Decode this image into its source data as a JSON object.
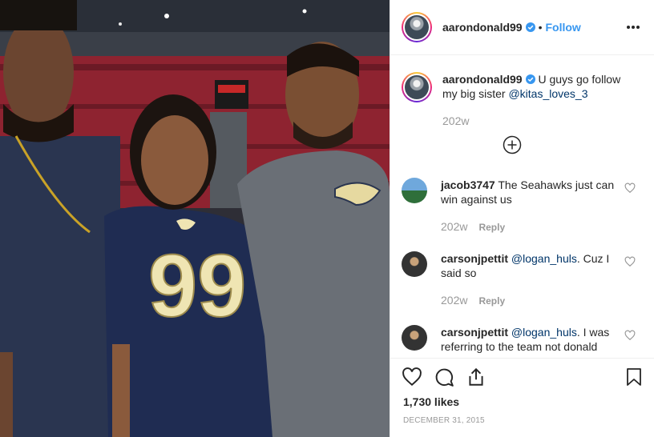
{
  "post": {
    "author": "aarondonald99",
    "follow_label": "Follow",
    "separator": "•",
    "more_icon": "more-horizontal-icon",
    "verified_icon": "verified-badge-icon",
    "colors": {
      "link": "#3897f0",
      "mention": "#003569",
      "muted": "#999999",
      "text": "#262626"
    }
  },
  "caption": {
    "user": "aarondonald99",
    "text": "U guys go follow my big sister ",
    "mention": "@kitas_loves_3",
    "time": "202w",
    "load_more_icon": "plus-circle-icon"
  },
  "comments": [
    {
      "user": "jacob3747",
      "text": "The Seahawks just can win against us",
      "mention": "",
      "time": "202w",
      "reply": "Reply"
    },
    {
      "user": "carsonjpettit",
      "mention": "@logan_huls",
      "text": ". Cuz I said so",
      "time": "202w",
      "reply": "Reply"
    },
    {
      "user": "carsonjpettit",
      "mention": "@logan_huls",
      "text": ". I was referring to the team not donald",
      "time": "",
      "reply": ""
    }
  ],
  "actions": {
    "like_icon": "heart-icon",
    "comment_icon": "comment-icon",
    "share_icon": "share-icon",
    "save_icon": "bookmark-icon",
    "likes": "1,730 likes",
    "date": "DECEMBER 31, 2015"
  },
  "photo": {
    "jersey_number": "99"
  }
}
